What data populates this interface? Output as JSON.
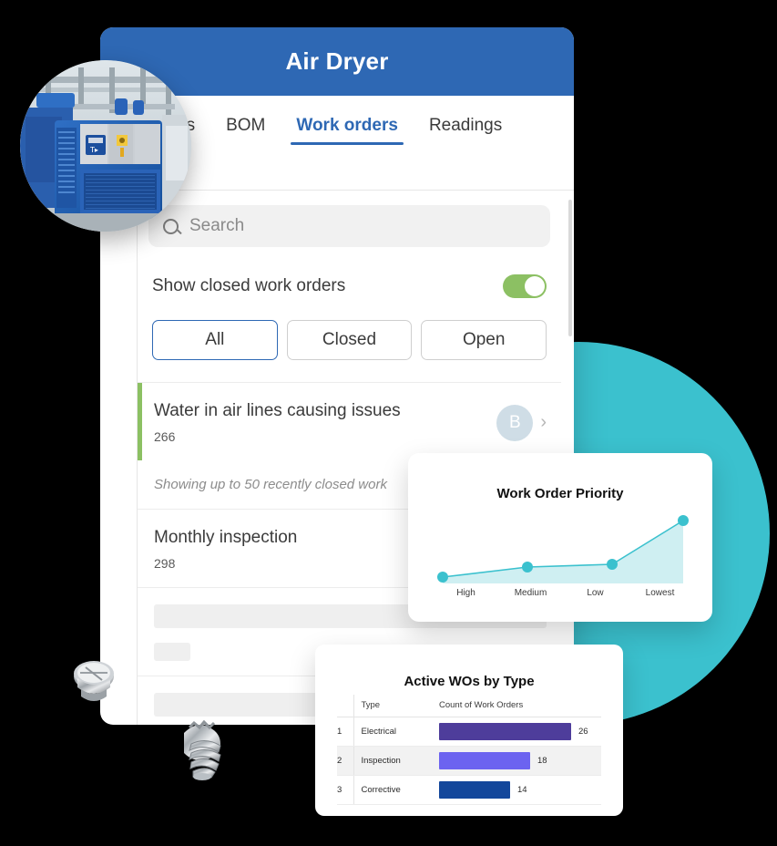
{
  "app": {
    "header_title": "Air Dryer",
    "header_color": "#2E68B4",
    "accent_green": "#8CC063",
    "accent_teal": "#3BC1CE"
  },
  "tabs": [
    {
      "label": "Details",
      "active": false
    },
    {
      "label": "BOM",
      "active": false
    },
    {
      "label": "Work orders",
      "active": true
    },
    {
      "label": "Readings",
      "active": false
    }
  ],
  "search": {
    "placeholder": "Search",
    "value": "",
    "icon": "search-icon"
  },
  "toggle": {
    "label": "Show closed work orders",
    "state": "on"
  },
  "filters": [
    {
      "label": "All",
      "selected": true
    },
    {
      "label": "Closed",
      "selected": false
    },
    {
      "label": "Open",
      "selected": false
    }
  ],
  "work_orders": [
    {
      "title": "Water in air lines causing issues",
      "id": "266",
      "avatar": "B",
      "chevron": "chevron-right-icon"
    },
    {
      "title": "Monthly inspection",
      "id": "298"
    }
  ],
  "list_note": "Showing up to 50 recently closed work",
  "photo": {
    "alt": "industrial air dryer unit"
  },
  "chart_data": [
    {
      "type": "area",
      "title": "Work Order Priority",
      "categories": [
        "High",
        "Medium",
        "Low",
        "Lowest"
      ],
      "values": [
        8,
        26,
        30,
        72
      ],
      "ylim": [
        0,
        80
      ],
      "xlabel": "",
      "ylabel": "",
      "grid": false,
      "legend": "none",
      "series_color": "#3BC1CE",
      "fill_color": "#CFEFF2"
    },
    {
      "type": "bar",
      "title": "Active WOs by Type",
      "columns": [
        "",
        "Type",
        "Count of Work Orders"
      ],
      "categories": [
        "Electrical",
        "Inspection",
        "Corrective"
      ],
      "values": [
        26,
        18,
        14
      ],
      "row_numbers": [
        "1",
        "2",
        "3"
      ],
      "bar_colors": [
        "#4E3D9B",
        "#6C63F0",
        "#13479B"
      ],
      "xlabel": "Count of Work Orders",
      "ylabel": "Type",
      "grid": false,
      "legend": "none"
    }
  ]
}
